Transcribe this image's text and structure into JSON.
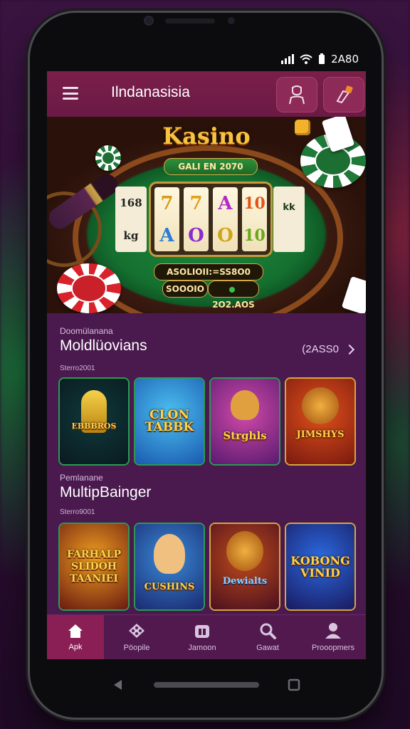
{
  "status_bar": {
    "time": "2A80"
  },
  "app_bar": {
    "title": "Ilndanasisia"
  },
  "hero": {
    "title": "Kasino",
    "subtitle": "GALI EN 2070",
    "reels": [
      [
        "7",
        "A"
      ],
      [
        "7",
        "O"
      ],
      [
        "A",
        "O"
      ],
      [
        "10",
        "10"
      ]
    ],
    "side_reel_left": [
      "168",
      "kg"
    ],
    "side_reel_right": [
      "kk"
    ],
    "jackpot_text": "ASOLIOII:=SS8O0",
    "balance_left": "SOOOIO",
    "balance_right": "2O2.AOS"
  },
  "section1": {
    "kicker": "Doomülanana",
    "title": "Moldlüovians",
    "meta": "Sterro2001",
    "see_all": "(2ASS0",
    "tiles": [
      {
        "label": "EBBBROS"
      },
      {
        "label": "CLON TABBK"
      },
      {
        "label": "Strghls"
      },
      {
        "label": "JIMSHYS"
      }
    ]
  },
  "section2": {
    "kicker": "Pemlanane",
    "title": "MultipBainger",
    "meta": "Sterro9001",
    "tiles": [
      {
        "label": "FARHALP SLIDOH TAANIEI"
      },
      {
        "label": "CUSHINS"
      },
      {
        "label": "Dewialts"
      },
      {
        "label": "KOBONG VINID"
      }
    ]
  },
  "bottom_nav": [
    {
      "label": "Apk",
      "icon": "home-icon"
    },
    {
      "label": "Pöopile",
      "icon": "dice-icon"
    },
    {
      "label": "Jamoon",
      "icon": "bag-icon"
    },
    {
      "label": "Gawat",
      "icon": "search-icon"
    },
    {
      "label": "Prooopmers",
      "icon": "user-icon"
    }
  ],
  "colors": {
    "accent": "#8a1f55",
    "background": "#4a1a4e",
    "gold": "#f6c340"
  }
}
